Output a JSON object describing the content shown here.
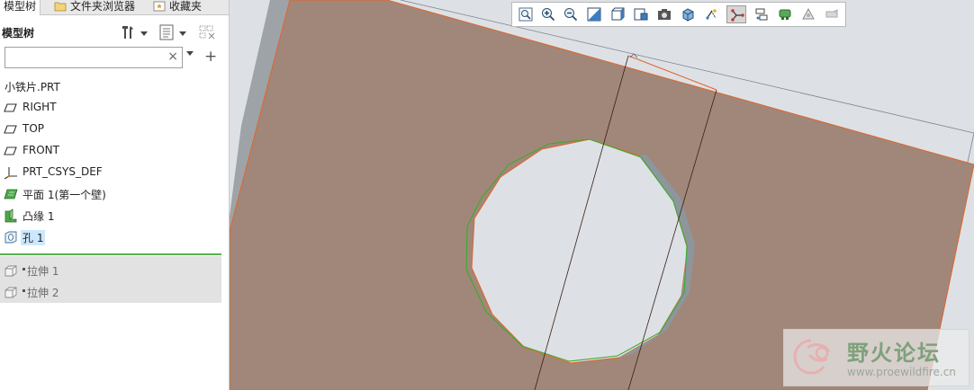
{
  "tabs": [
    {
      "label": "模型树",
      "active": true
    },
    {
      "label": "文件夹浏览器",
      "active": false
    },
    {
      "label": "收藏夹",
      "active": false
    }
  ],
  "model_tree": {
    "title": "模型树",
    "search": {
      "value": "",
      "placeholder": ""
    },
    "root": "小铁片.PRT",
    "items": [
      {
        "label": "RIGHT",
        "icon": "datum-plane-icon"
      },
      {
        "label": "TOP",
        "icon": "datum-plane-icon"
      },
      {
        "label": "FRONT",
        "icon": "datum-plane-icon"
      },
      {
        "label": "PRT_CSYS_DEF",
        "icon": "coordinate-system-icon"
      },
      {
        "label": "平面 1(第一个壁)",
        "icon": "sheetmetal-wall-icon"
      },
      {
        "label": "凸缘 1",
        "icon": "flange-icon"
      },
      {
        "label": "孔 1",
        "icon": "hole-icon",
        "selected": true
      }
    ],
    "suppressed_items": [
      {
        "label": "拉伸 1",
        "icon": "extrude-icon"
      },
      {
        "label": "拉伸 2",
        "icon": "extrude-icon"
      }
    ]
  },
  "view_toolbar": [
    {
      "name": "zoom-fit-icon"
    },
    {
      "name": "zoom-in-icon"
    },
    {
      "name": "zoom-out-icon"
    },
    {
      "name": "repaint-icon"
    },
    {
      "name": "display-style-icon"
    },
    {
      "name": "saved-orientations-icon"
    },
    {
      "name": "view-manager-icon"
    },
    {
      "name": "perspective-view-icon"
    },
    {
      "name": "datum-display-icon"
    },
    {
      "name": "annotation-display-icon",
      "active": true
    },
    {
      "name": "spin-center-icon"
    },
    {
      "name": "appearance-icon"
    },
    {
      "name": "simulation-icon"
    },
    {
      "name": "more-icon"
    }
  ],
  "watermark": {
    "brand": "野火论坛",
    "url": "www.proewildfire.cn"
  },
  "colors": {
    "model_face": "#a18779",
    "model_edge": "#e0652b",
    "hole_edge": "#3daa2f",
    "viewport_bg": "#dde1e6",
    "selection_bg": "#cce8ff",
    "insert_line": "#56b24d"
  }
}
